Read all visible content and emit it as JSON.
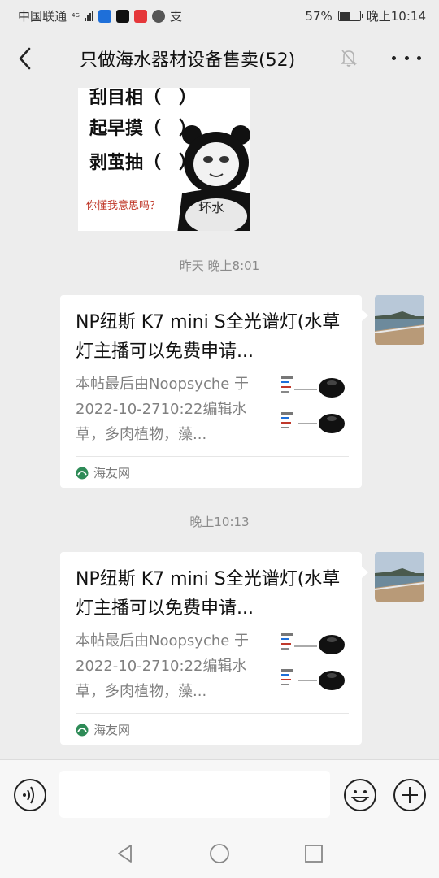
{
  "status_bar": {
    "carrier": "中国联通",
    "network": "4G",
    "signal_bars": 4,
    "extra_glyph": "支",
    "battery_percent": "57%",
    "battery_level": 0.57,
    "time": "晚上10:14",
    "app_icons": [
      {
        "name": "message-app-icon",
        "color": "#1e6fd9"
      },
      {
        "name": "tiktok-icon",
        "color": "#111111"
      },
      {
        "name": "huawei-icon",
        "color": "#e5373a"
      },
      {
        "name": "browser-icon",
        "color": "#555555"
      }
    ]
  },
  "header": {
    "title": "只做海水器材设备售卖(52)",
    "back_icon": "chevron-left-icon",
    "mute_icon": "bell-off-icon",
    "more_icon": "more-dots-icon"
  },
  "meme": {
    "lines": [
      "刮目相（　）",
      "起早摸（　）",
      "剥茧抽（　）"
    ],
    "caption": "你懂我意思吗？",
    "panda_text": "坏水"
  },
  "messages": [
    {
      "time": "昨天 晚上8:01",
      "title": "NP纽斯 K7 mini S全光谱灯(水草灯主播可以免费申请...",
      "description": "本帖最后由Noopsyche 于2022-10-2710:22编辑水草，多肉植物，藻...",
      "source": "海友网"
    },
    {
      "time": "晚上10:13",
      "title": "NP纽斯 K7 mini S全光谱灯(水草灯主播可以免费申请...",
      "description": "本帖最后由Noopsyche 于2022-10-2710:22编辑水草，多肉植物，藻...",
      "source": "海友网"
    }
  ],
  "input": {
    "value": "",
    "placeholder": ""
  },
  "colors": {
    "background": "#ededed",
    "bubble": "#ffffff",
    "timestamp": "#8a8a8a",
    "source_icon": "#2e8b57"
  }
}
